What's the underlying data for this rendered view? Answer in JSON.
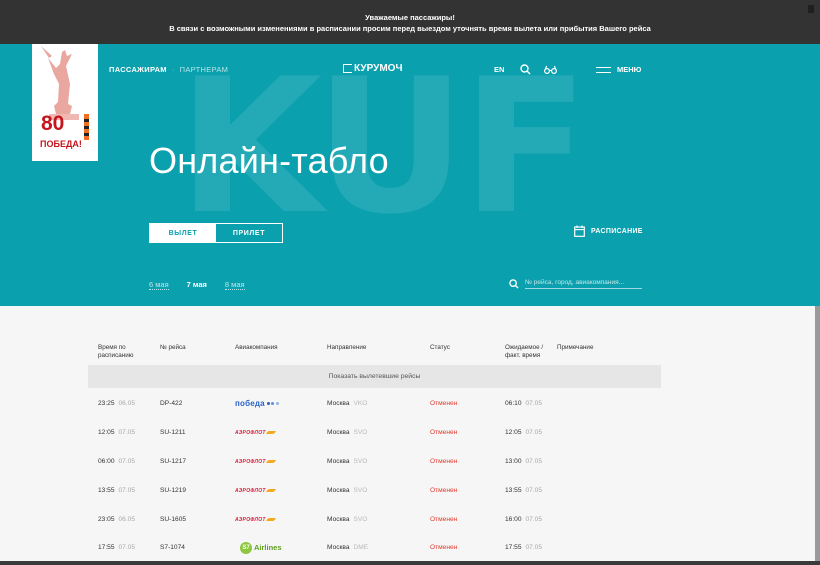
{
  "notice": {
    "line1": "Уважаемые пассажиры!",
    "line2": "В связи с возможными изменениями в расписании  просим перед выездом уточнять время вылета или прибытия Вашего рейса"
  },
  "badge": {
    "number": "80",
    "text": "ПОБЕДА!"
  },
  "nav": {
    "passengers": "ПАССАЖИРАМ",
    "partners": "ПАРТНЕРАМ",
    "logo": "КУРУМОЧ",
    "lang": "EN",
    "menu": "МЕНЮ"
  },
  "hero": {
    "watermark": "KUF",
    "title": "Онлайн-табло",
    "tab_departure": "ВЫЛЕТ",
    "tab_arrival": "ПРИЛЕТ",
    "schedule": "РАСПИСАНИЕ",
    "dates": [
      "6 мая",
      "7 мая",
      "8 мая"
    ],
    "active_date": "7 мая",
    "search_placeholder": "№ рейса, город, авиакомпания..."
  },
  "colors": {
    "brand": "#0aa0ad",
    "status_cancelled": "#e2392b"
  },
  "table": {
    "headers": {
      "time": "Время по расписанию",
      "flight": "№ рейса",
      "airline": "Авиакомпания",
      "direction": "Направление",
      "status": "Статус",
      "expected": "Ожидаемое / факт. время",
      "note": "Примечание"
    },
    "show_past": "Показать вылетевшие рейсы",
    "rows": [
      {
        "time": "23:25",
        "date": "06.05",
        "flight": "DP-422",
        "airline": "победа",
        "city": "Москва",
        "code": "VKO",
        "status": "Отменен",
        "expected": "06:10",
        "exp_date": "07.05"
      },
      {
        "time": "12:05",
        "date": "07.05",
        "flight": "SU-1211",
        "airline": "АЭРОФЛОТ",
        "city": "Москва",
        "code": "SVO",
        "status": "Отменен",
        "expected": "12:05",
        "exp_date": "07.05"
      },
      {
        "time": "06:00",
        "date": "07.05",
        "flight": "SU-1217",
        "airline": "АЭРОФЛОТ",
        "city": "Москва",
        "code": "SVO",
        "status": "Отменен",
        "expected": "13:00",
        "exp_date": "07.05"
      },
      {
        "time": "13:55",
        "date": "07.05",
        "flight": "SU-1219",
        "airline": "АЭРОФЛОТ",
        "city": "Москва",
        "code": "SVO",
        "status": "Отменен",
        "expected": "13:55",
        "exp_date": "07.05"
      },
      {
        "time": "23:05",
        "date": "06.05",
        "flight": "SU-1605",
        "airline": "АЭРОФЛОТ",
        "city": "Москва",
        "code": "SVO",
        "status": "Отменен",
        "expected": "16:00",
        "exp_date": "07.05"
      },
      {
        "time": "17:55",
        "date": "07.05",
        "flight": "S7-1074",
        "airline": "Airlines",
        "city": "Москва",
        "code": "DME",
        "status": "Отменен",
        "expected": "17:55",
        "exp_date": "07.05"
      }
    ]
  }
}
